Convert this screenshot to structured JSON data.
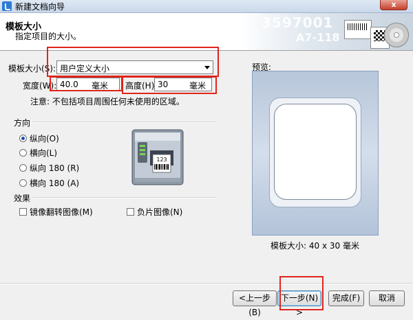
{
  "window": {
    "title": "新建文档向导",
    "close_label": "x"
  },
  "header": {
    "title": "模板大小",
    "subtitle": "指定项目的大小。",
    "deco_num1": "3597001",
    "deco_num2": "A7-118"
  },
  "form": {
    "template_size_label": "模板大小(S):",
    "template_size_value": "用户定义大小",
    "width_label": "宽度(W):",
    "width_value": "40.0",
    "width_unit": "毫米",
    "height_label": "高度(H):",
    "height_value": "30",
    "height_unit": "毫米",
    "note": "注意: 不包括项目周围任何未使用的区域。"
  },
  "orientation": {
    "title": "方向",
    "options": [
      {
        "label": "纵向(O)",
        "selected": true
      },
      {
        "label": "横向(L)",
        "selected": false
      },
      {
        "label": "纵向 180 (R)",
        "selected": false
      },
      {
        "label": "横向 180 (A)",
        "selected": false
      }
    ]
  },
  "printer": {
    "label_text": "123"
  },
  "effects": {
    "title": "效果",
    "mirror_label": "镜像翻转图像(M)",
    "negative_label": "负片图像(N)"
  },
  "preview": {
    "label": "预览:",
    "size_text": "模板大小: 40 x 30 毫米"
  },
  "buttons": {
    "back": "<上一步(B)",
    "next": "下一步(N) >",
    "finish": "完成(F)",
    "cancel": "取消"
  },
  "colors": {
    "highlight_red": "#e0241a",
    "preview_bg": "#c4d2e4"
  }
}
